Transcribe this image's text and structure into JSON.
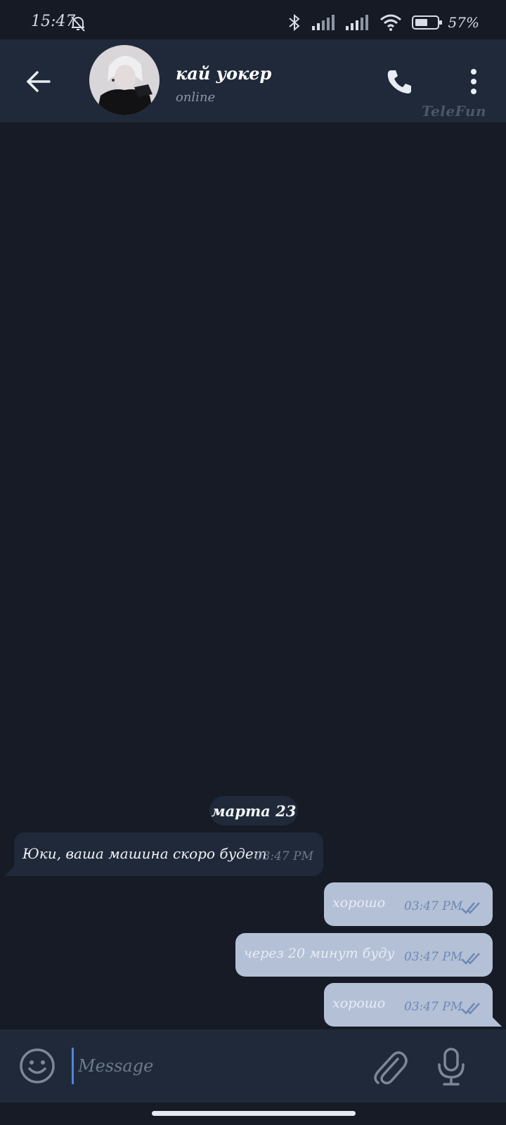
{
  "status_bar": {
    "time": "15:47",
    "battery_percent": "57%"
  },
  "header": {
    "contact_name": "кай уокер",
    "contact_status": "online",
    "watermark": "TeleFun"
  },
  "chat": {
    "date_label": "марта 23",
    "messages": [
      {
        "direction": "incoming",
        "text": "Юки, ваша машина скоро будет",
        "time": "03:47 PM"
      },
      {
        "direction": "outgoing",
        "text": "хорошо",
        "time": "03:47 PM",
        "status": "read"
      },
      {
        "direction": "outgoing",
        "text": "через 20 минут буду",
        "time": "03:47 PM",
        "status": "read"
      },
      {
        "direction": "outgoing",
        "text": "хорошо",
        "time": "03:47 PM",
        "status": "read"
      }
    ]
  },
  "input": {
    "placeholder": "Message",
    "value": ""
  },
  "icons": {
    "back": "arrow-left-icon",
    "call": "phone-icon",
    "menu": "more-vertical-icon",
    "emoji": "smile-icon",
    "attach": "paperclip-icon",
    "mic": "microphone-icon"
  },
  "colors": {
    "background": "#161b26",
    "header": "#1f2939",
    "incoming_bubble": "#1f2939",
    "outgoing_bubble": "#b3c0d6",
    "read_ticks": "#6f88b4",
    "accent": "#4f86d9"
  }
}
